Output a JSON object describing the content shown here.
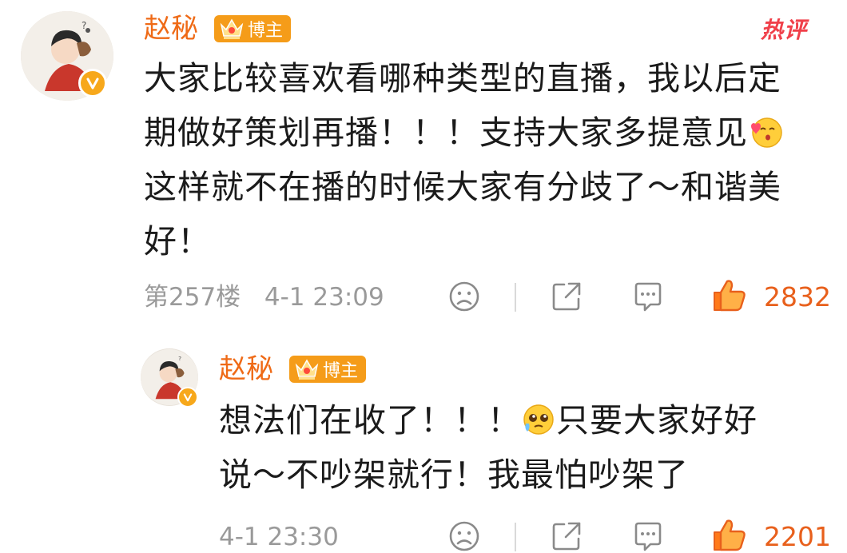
{
  "comments": [
    {
      "username": "赵秘",
      "role_badge": "博主",
      "hot_label": "热评",
      "text_parts": [
        "大家比较喜欢看哪种类型的直播，我以后定期做好策划再播！！！支持大家多提意见",
        "这样就不在播的时候大家有分歧了～和谐美好！"
      ],
      "text_lines": [
        "大家比较喜欢看哪种类型的直播，我以后定",
        "期做好策划再播！！！支持大家多提意见",
        "这样就不在播的时候大家有分歧了～和谐美",
        "好！"
      ],
      "floor": "第257楼",
      "time": "4-1 23:09",
      "likes": "2832",
      "emoji": "kiss-emoji"
    },
    {
      "username": "赵秘",
      "role_badge": "博主",
      "text_lines": [
        "想法们在收了！！！",
        "只要大家好好",
        "说～不吵架就行！我最怕吵架了"
      ],
      "time": "4-1 23:30",
      "likes": "2201",
      "emoji": "pleading-emoji"
    }
  ],
  "colors": {
    "username": "#ef6a16",
    "badge_bg": "#f59c19",
    "hot": "#f0404a",
    "like": "#e8601c",
    "meta": "#9a9a9a"
  },
  "icons": [
    "verified-v-icon",
    "crown-icon",
    "dislike-face-icon",
    "share-icon",
    "comment-icon",
    "thumbs-up-icon"
  ]
}
